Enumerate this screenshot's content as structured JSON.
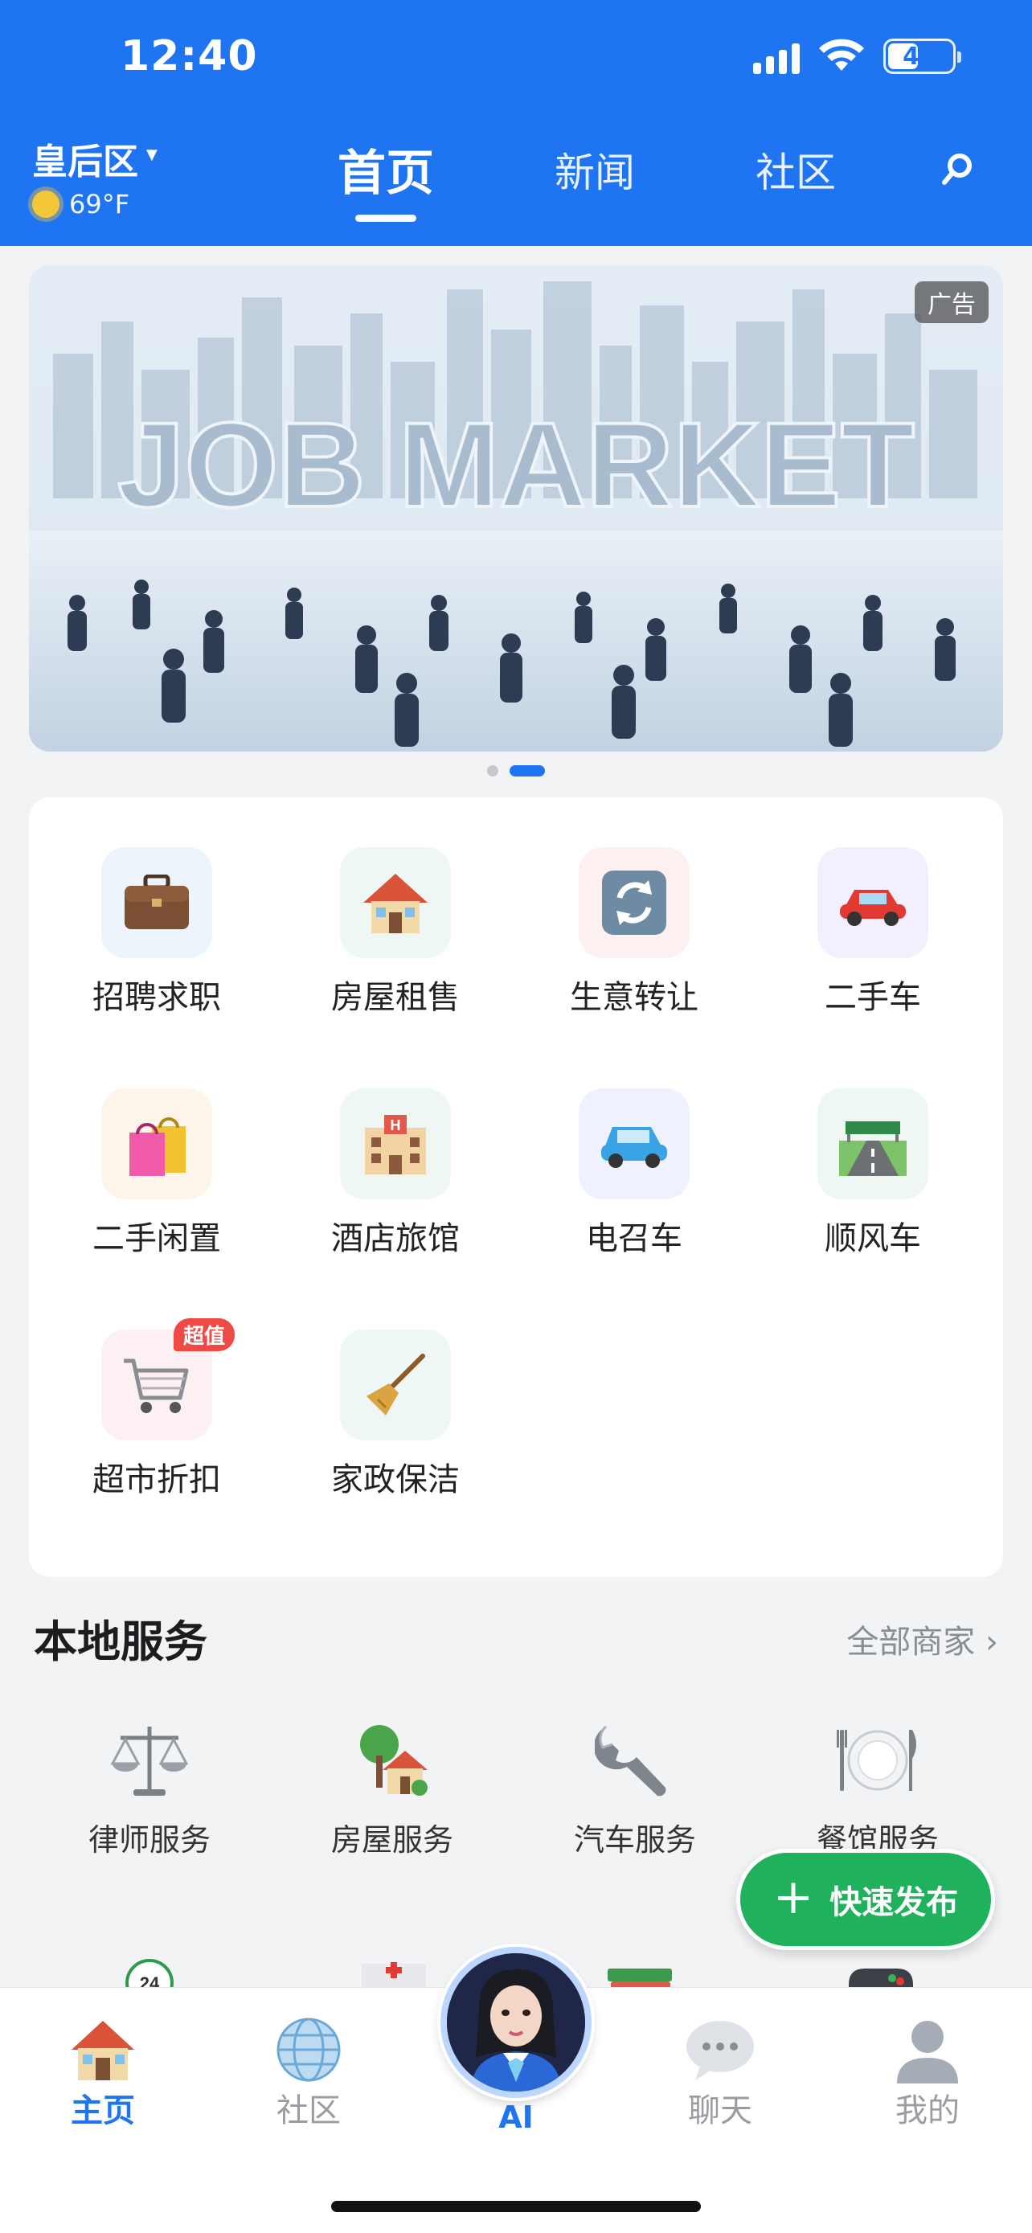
{
  "status_bar": {
    "time": "12:40",
    "battery": "44"
  },
  "header": {
    "location": "皇后区",
    "weather": "69°F",
    "tabs": [
      {
        "label": "首页",
        "active": true
      },
      {
        "label": "新闻",
        "active": false
      },
      {
        "label": "社区",
        "active": false
      }
    ],
    "search_icon": "search-icon",
    "accent_color": "#1f74f2"
  },
  "banner": {
    "ad_label": "广告",
    "headline": "JOB MARKET",
    "page_count": 2,
    "active_page": 2
  },
  "categories": [
    {
      "label": "招聘求职",
      "icon": "briefcase-icon"
    },
    {
      "label": "房屋租售",
      "icon": "house-icon"
    },
    {
      "label": "生意转让",
      "icon": "transfer-icon"
    },
    {
      "label": "二手车",
      "icon": "car-icon"
    },
    {
      "label": "二手闲置",
      "icon": "shopping-bags-icon"
    },
    {
      "label": "酒店旅馆",
      "icon": "hotel-icon"
    },
    {
      "label": "电召车",
      "icon": "taxi-icon"
    },
    {
      "label": "顺风车",
      "icon": "highway-icon"
    },
    {
      "label": "超市折扣",
      "icon": "cart-icon",
      "badge": "超值"
    },
    {
      "label": "家政保洁",
      "icon": "broom-icon"
    }
  ],
  "local_services": {
    "title": "本地服务",
    "more": "全部商家 ›",
    "items": [
      {
        "label": "律师服务",
        "icon": "scales-icon"
      },
      {
        "label": "房屋服务",
        "icon": "house-tree-icon"
      },
      {
        "label": "汽车服务",
        "icon": "wrench-icon"
      },
      {
        "label": "餐馆服务",
        "icon": "plate-icon"
      }
    ]
  },
  "fab": {
    "label": "快速发布",
    "plus": "+"
  },
  "bottom_nav": [
    {
      "label": "主页",
      "icon": "home-icon",
      "active": true
    },
    {
      "label": "社区",
      "icon": "globe-icon",
      "active": false
    },
    {
      "label": "AI",
      "icon": "ai-avatar-icon",
      "active": false
    },
    {
      "label": "聊天",
      "icon": "chat-icon",
      "active": false
    },
    {
      "label": "我的",
      "icon": "profile-icon",
      "active": false
    }
  ]
}
